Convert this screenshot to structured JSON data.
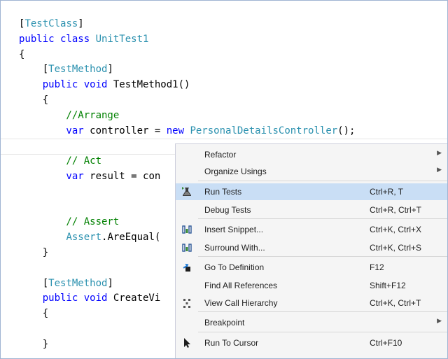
{
  "code_lines": [
    [
      {
        "t": "[",
        "c": "txt"
      },
      {
        "t": "TestClass",
        "c": "type"
      },
      {
        "t": "]",
        "c": "txt"
      }
    ],
    [
      {
        "t": "public class ",
        "c": "kw"
      },
      {
        "t": "UnitTest1",
        "c": "type"
      }
    ],
    [
      {
        "t": "{",
        "c": "txt"
      }
    ],
    [
      {
        "t": "    [",
        "c": "txt"
      },
      {
        "t": "TestMethod",
        "c": "type"
      },
      {
        "t": "]",
        "c": "txt"
      }
    ],
    [
      {
        "t": "    public void ",
        "c": "kw"
      },
      {
        "t": "TestMethod1()",
        "c": "txt"
      }
    ],
    [
      {
        "t": "    {",
        "c": "txt"
      }
    ],
    [
      {
        "t": "        //Arrange",
        "c": "cm"
      }
    ],
    [
      {
        "t": "        var ",
        "c": "kw"
      },
      {
        "t": "controller = ",
        "c": "txt"
      },
      {
        "t": "new ",
        "c": "kw"
      },
      {
        "t": "PersonalDetailsController",
        "c": "type"
      },
      {
        "t": "();",
        "c": "txt"
      }
    ],
    [
      {
        "t": "",
        "c": "txt"
      }
    ],
    [
      {
        "t": "        // Act",
        "c": "cm"
      }
    ],
    [
      {
        "t": "        var ",
        "c": "kw"
      },
      {
        "t": "result = con",
        "c": "txt"
      }
    ],
    [
      {
        "t": "",
        "c": "txt"
      }
    ],
    [
      {
        "t": "",
        "c": "txt"
      }
    ],
    [
      {
        "t": "        // Assert",
        "c": "cm"
      }
    ],
    [
      {
        "t": "        ",
        "c": "txt"
      },
      {
        "t": "Assert",
        "c": "type"
      },
      {
        "t": ".AreEqual(",
        "c": "txt"
      }
    ],
    [
      {
        "t": "    }",
        "c": "txt"
      }
    ],
    [
      {
        "t": "",
        "c": "txt"
      }
    ],
    [
      {
        "t": "    [",
        "c": "txt"
      },
      {
        "t": "TestMethod",
        "c": "type"
      },
      {
        "t": "]",
        "c": "txt"
      }
    ],
    [
      {
        "t": "    public void ",
        "c": "kw"
      },
      {
        "t": "CreateVi",
        "c": "txt"
      }
    ],
    [
      {
        "t": "    {",
        "c": "txt"
      }
    ],
    [
      {
        "t": "",
        "c": "txt"
      }
    ],
    [
      {
        "t": "    }",
        "c": "txt"
      }
    ]
  ],
  "colors": {
    "kw": "#0000ff",
    "type": "#2b91af",
    "cm": "#008000",
    "txt": "#000000",
    "highlight": "#c9def5",
    "menu_bg": "#f5f5f5"
  },
  "menu": {
    "items": [
      {
        "name": "refactor",
        "label": "Refactor",
        "shortcut": "",
        "submenu": true,
        "icon": ""
      },
      {
        "name": "organize-usings",
        "label": "Organize Usings",
        "shortcut": "",
        "submenu": true,
        "icon": ""
      },
      {
        "name": "run-tests",
        "label": "Run Tests",
        "shortcut": "Ctrl+R, T",
        "submenu": false,
        "icon": "run-tests-icon",
        "highlighted": true
      },
      {
        "name": "debug-tests",
        "label": "Debug Tests",
        "shortcut": "Ctrl+R, Ctrl+T",
        "submenu": false,
        "icon": ""
      },
      {
        "name": "insert-snippet",
        "label": "Insert Snippet...",
        "shortcut": "Ctrl+K, Ctrl+X",
        "submenu": false,
        "icon": "snippet-icon"
      },
      {
        "name": "surround-with",
        "label": "Surround With...",
        "shortcut": "Ctrl+K, Ctrl+S",
        "submenu": false,
        "icon": "snippet-icon"
      },
      {
        "name": "go-to-definition",
        "label": "Go To Definition",
        "shortcut": "F12",
        "submenu": false,
        "icon": "go-to-definition-icon"
      },
      {
        "name": "find-all-references",
        "label": "Find All References",
        "shortcut": "Shift+F12",
        "submenu": false,
        "icon": ""
      },
      {
        "name": "view-call-hierarchy",
        "label": "View Call Hierarchy",
        "shortcut": "Ctrl+K, Ctrl+T",
        "submenu": false,
        "icon": "call-hierarchy-icon"
      },
      {
        "name": "breakpoint",
        "label": "Breakpoint",
        "shortcut": "",
        "submenu": true,
        "icon": ""
      },
      {
        "name": "run-to-cursor",
        "label": "Run To Cursor",
        "shortcut": "Ctrl+F10",
        "submenu": false,
        "icon": "cursor-arrow-icon"
      }
    ]
  }
}
